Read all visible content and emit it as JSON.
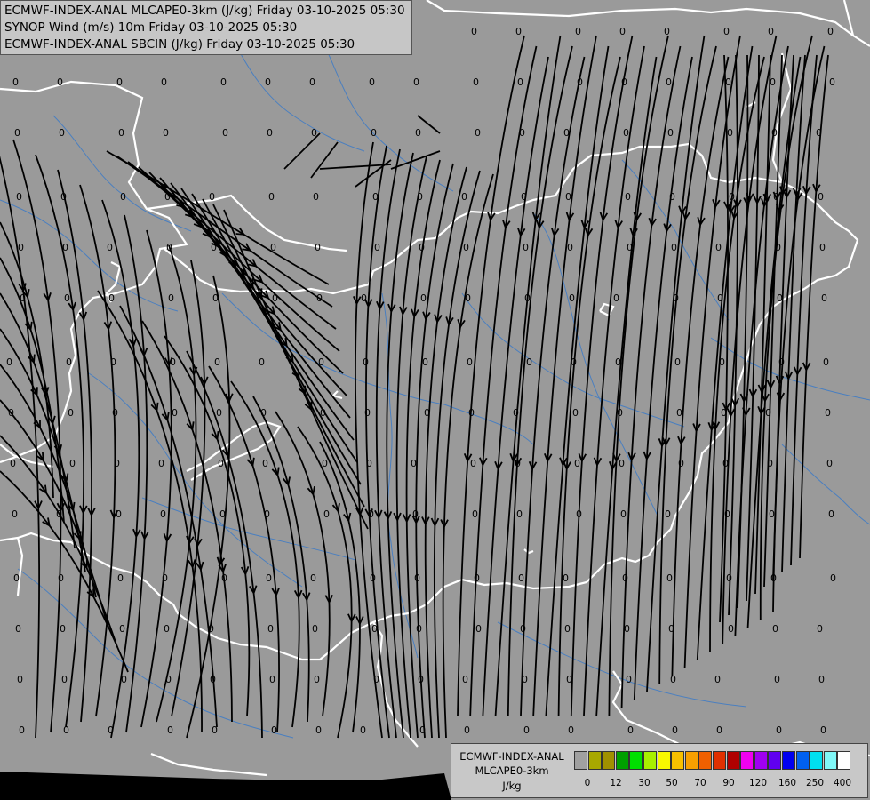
{
  "title_lines": [
    "ECMWF-INDEX-ANAL MLCAPE0-3km (J/kg) Friday 03-10-2025 05:30",
    "SYNOP Wind (m/s) 10m Friday 03-10-2025 05:30",
    "ECMWF-INDEX-ANAL SBCIN (J/kg) Friday 03-10-2025 05:30"
  ],
  "station_value": "0",
  "legend": {
    "name_line1": "ECMWF-INDEX-ANAL",
    "name_line2": "MLCAPE0-3km",
    "unit": "J/kg",
    "colors": [
      "#a0a0a0",
      "#a8a800",
      "#a09000",
      "#00a000",
      "#00e000",
      "#a8f000",
      "#f8f800",
      "#f8c000",
      "#f8a000",
      "#f06000",
      "#e03000",
      "#b00000",
      "#f000f0",
      "#a000f0",
      "#6000f0",
      "#0000f0",
      "#0060f0",
      "#00e0f0",
      "#80f8f8",
      "#ffffff"
    ],
    "ticks": [
      "0",
      "12",
      "30",
      "50",
      "70",
      "90",
      "120",
      "160",
      "250",
      "400"
    ]
  },
  "colors": {
    "background": "#9a9a9a",
    "country_border": "#ffffff",
    "river": "#4a7fc0",
    "streamline": "#000000"
  }
}
